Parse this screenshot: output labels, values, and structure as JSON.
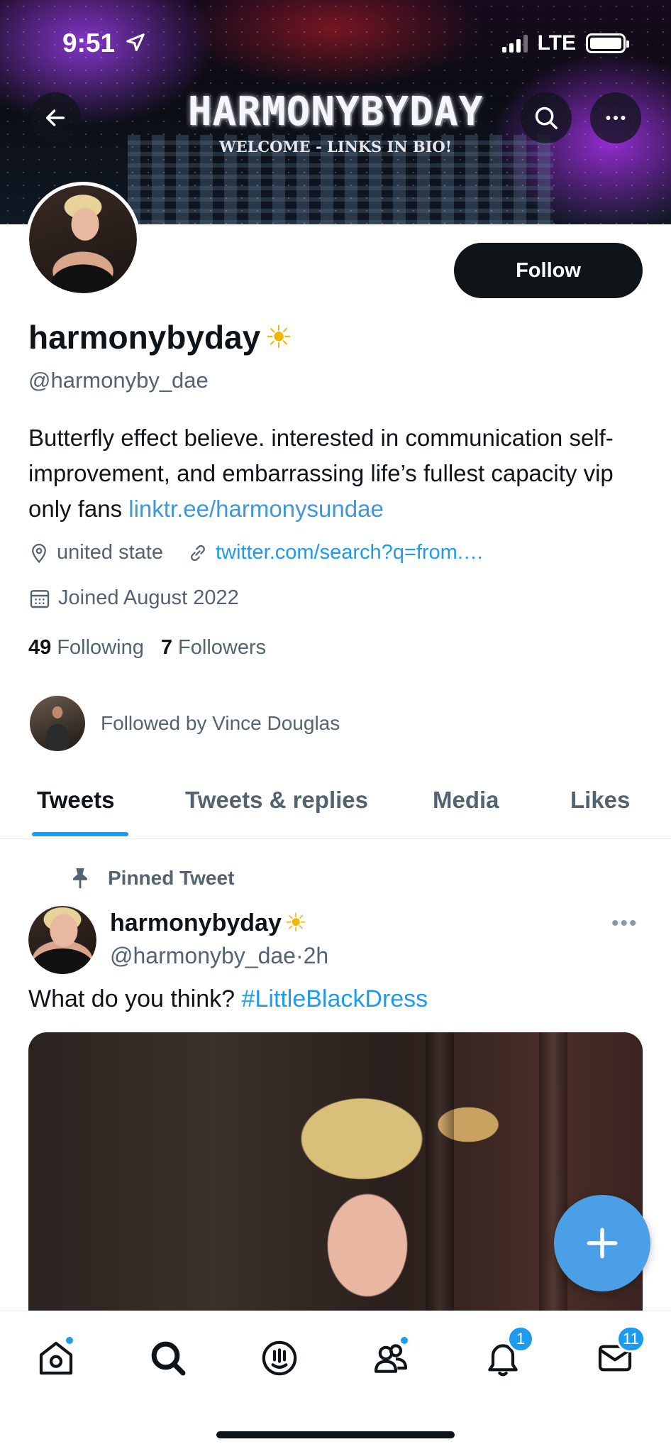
{
  "status_bar": {
    "time": "9:51",
    "network": "LTE"
  },
  "banner": {
    "title": "HARMONYBYDAY",
    "subtitle": "WELCOME - LINKS IN BIO!"
  },
  "profile": {
    "display_name": "harmonybyday",
    "emoji": "☀",
    "handle": "@harmonyby_dae",
    "follow_label": "Follow",
    "bio_text": "Butterfly effect believe. interested in communication self-improvement, and embarrassing life’s fullest capacity vip only fans ",
    "bio_link": "linktr.ee/harmonysundae",
    "location": "united state",
    "website": "twitter.com/search?q=from.…",
    "joined": "Joined August 2022",
    "following_count": "49",
    "following_label": "Following",
    "followers_count": "7",
    "followers_label": "Followers",
    "followed_by": "Followed by Vince Douglas"
  },
  "tabs": [
    {
      "label": "Tweets",
      "active": true
    },
    {
      "label": "Tweets & replies",
      "active": false
    },
    {
      "label": "Media",
      "active": false
    },
    {
      "label": "Likes",
      "active": false
    }
  ],
  "pinned_tweet": {
    "pinned_label": "Pinned Tweet",
    "author_name": "harmonybyday",
    "author_handle": "@harmonyby_dae",
    "separator": "·",
    "time_ago": "2h",
    "more": "•••",
    "text": "What do you think? ",
    "hashtag": "#LittleBlackDress"
  },
  "bottom_nav": {
    "items": [
      "home-icon",
      "search-icon",
      "spaces-icon",
      "communities-icon",
      "notifications-icon",
      "messages-icon"
    ],
    "notifications_badge": "1",
    "messages_badge": "11"
  },
  "colors": {
    "accent": "#1d9bf0",
    "text": "#0f1419",
    "secondary": "#536471",
    "follow_bg": "#0f1419"
  }
}
